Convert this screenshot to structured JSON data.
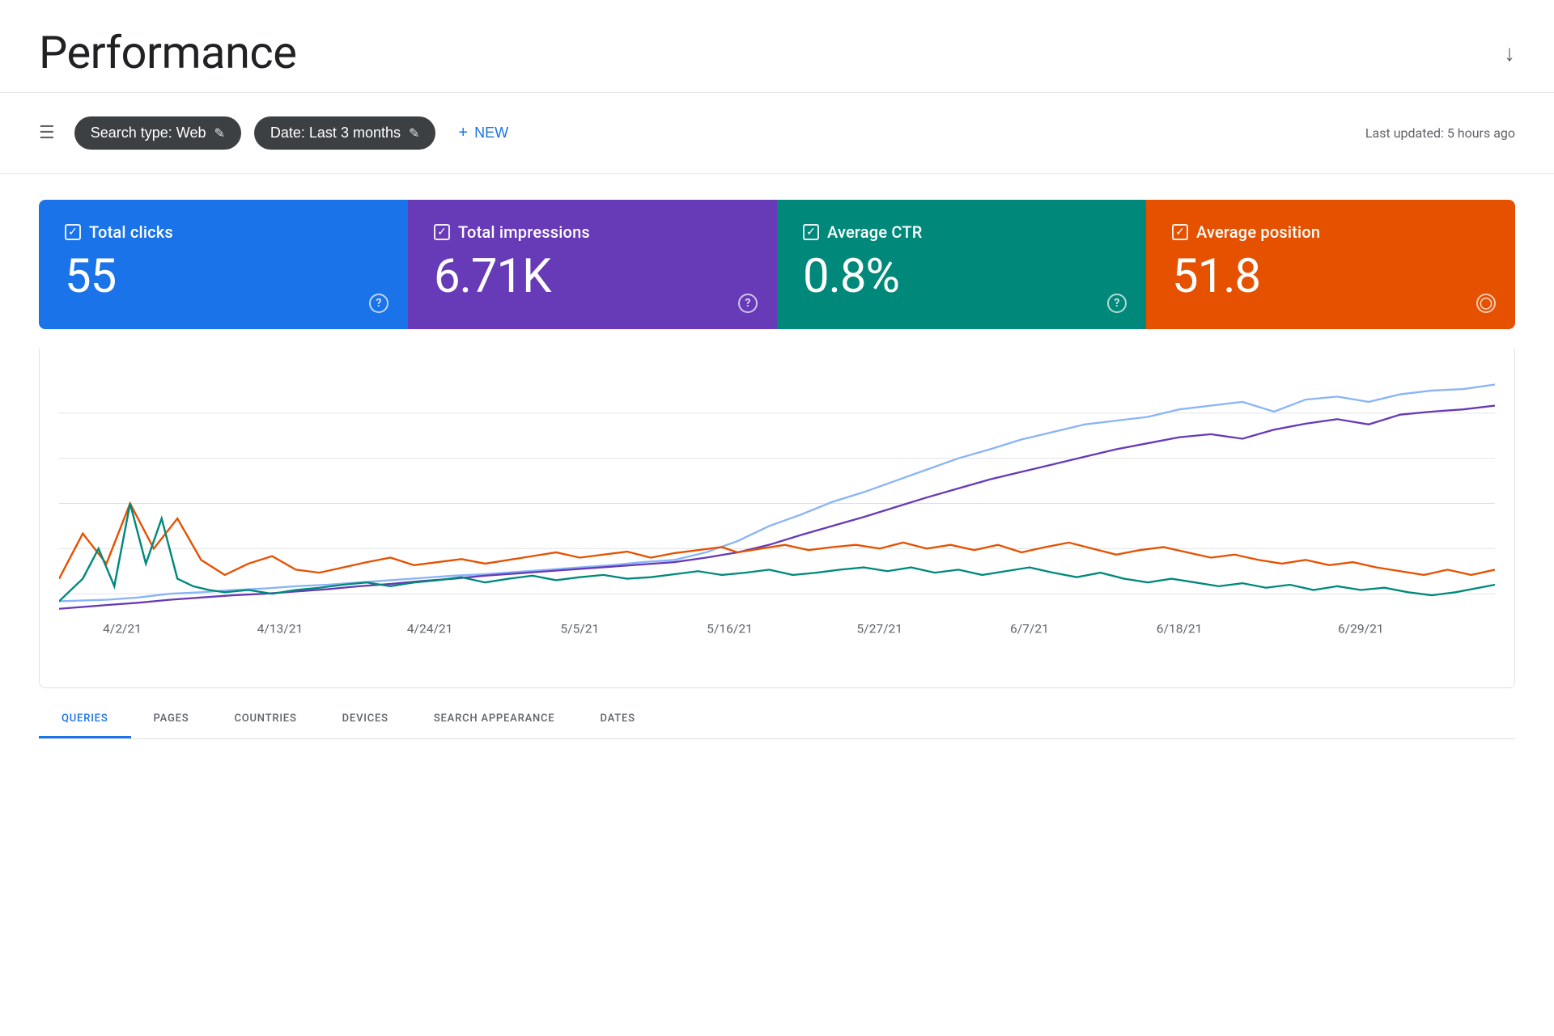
{
  "header": {
    "title": "Performance",
    "last_updated": "Last updated: 5 hours ago"
  },
  "toolbar": {
    "filter_icon_label": "≡",
    "search_type_label": "Search type: Web",
    "date_label": "Date: Last 3 months",
    "new_label": "NEW",
    "edit_icon": "✎"
  },
  "metrics": [
    {
      "id": "clicks",
      "label": "Total clicks",
      "value": "55",
      "color": "#1a73e8",
      "info": "?"
    },
    {
      "id": "impressions",
      "label": "Total impressions",
      "value": "6.71K",
      "color": "#673ab7",
      "info": "?"
    },
    {
      "id": "ctr",
      "label": "Average CTR",
      "value": "0.8%",
      "color": "#00897b",
      "info": "?"
    },
    {
      "id": "position",
      "label": "Average position",
      "value": "51.8",
      "color": "#e65100",
      "info": "⊙"
    }
  ],
  "chart": {
    "x_labels": [
      "4/2/21",
      "4/13/21",
      "4/24/21",
      "5/5/21",
      "5/16/21",
      "5/27/21",
      "6/7/21",
      "6/18/21",
      "6/29/21"
    ],
    "lines": {
      "clicks": {
        "color": "#1a73e8",
        "label": "Clicks"
      },
      "impressions": {
        "color": "#673ab7",
        "label": "Impressions"
      },
      "ctr": {
        "color": "#e65100",
        "label": "CTR"
      },
      "position": {
        "color": "#00897b",
        "label": "Position"
      }
    }
  },
  "bottom_tabs": [
    {
      "id": "queries",
      "label": "QUERIES",
      "active": true
    },
    {
      "id": "pages",
      "label": "PAGES",
      "active": false
    },
    {
      "id": "countries",
      "label": "COUNTRIES",
      "active": false
    },
    {
      "id": "devices",
      "label": "DEVICES",
      "active": false
    },
    {
      "id": "search_appearance",
      "label": "SEARCH APPEARANCE",
      "active": false
    },
    {
      "id": "dates",
      "label": "DATES",
      "active": false
    }
  ]
}
